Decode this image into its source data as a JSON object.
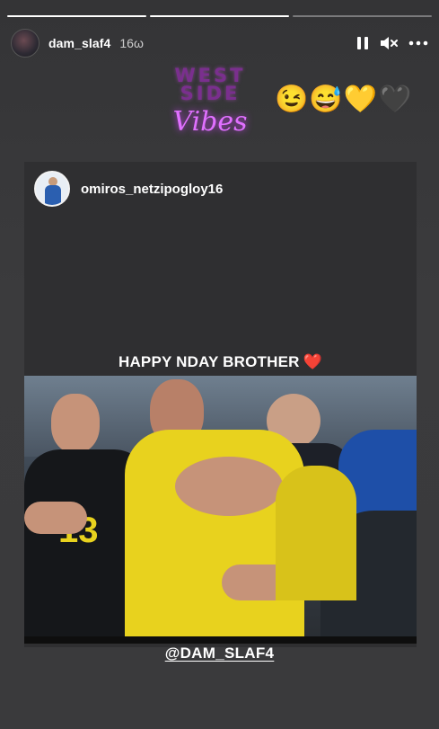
{
  "progress": [
    {
      "filled": 1.0
    },
    {
      "filled": 1.0
    },
    {
      "filled": 0.0
    }
  ],
  "header": {
    "username": "dam_slaf4",
    "time": "16ω",
    "icons": [
      "pause-icon",
      "mute-icon",
      "more-icon"
    ]
  },
  "sticker": {
    "line1": "WEST",
    "line2": "SIDE",
    "script": "Vibes"
  },
  "emojis": "😉😅💛🖤",
  "post": {
    "username": "omiros_netzipogloy16",
    "caption": "HAPPY NDAY BROTHER",
    "caption_emoji": "❤️"
  },
  "mention": "@DAM_SLAF4",
  "colors": {
    "background": "#3a3a3c",
    "card": "#2f2f31",
    "sticker_neon": "#e070ff",
    "jersey_yellow": "#e8d21e"
  }
}
